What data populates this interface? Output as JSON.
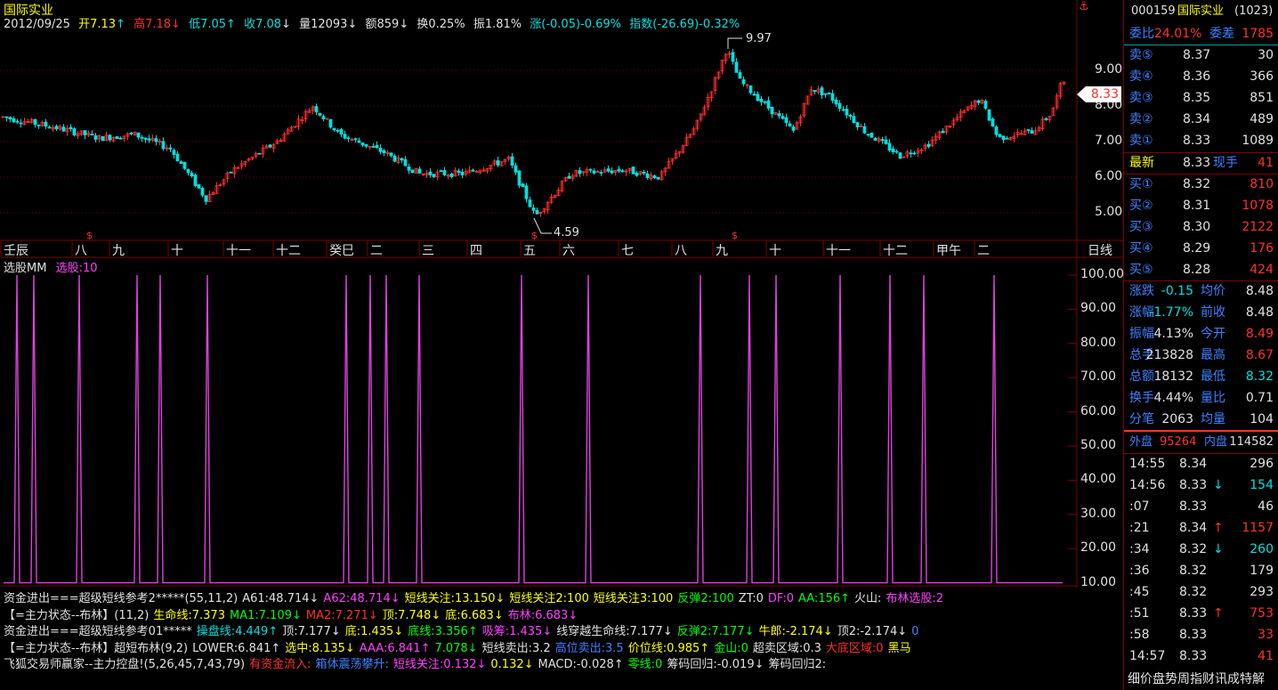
{
  "header": {
    "stock_name": "国际实业",
    "date": "2012/09/25",
    "open": "开7.13",
    "high": "高7.18",
    "low": "低7.05",
    "close": "收7.08",
    "volume": "量12093",
    "amount": "额859",
    "turnover": "换0.25%",
    "amplitude": "振1.81%",
    "change": "涨(-0.05)-0.69%",
    "index_change": "指数(-26.69)-0.32%"
  },
  "price_axis": [
    "9.00",
    "8.00",
    "7.00",
    "6.00",
    "5.00"
  ],
  "current_price_tag": "8.33",
  "high_mark": "9.97",
  "low_mark": "4.59",
  "time_axis": [
    "壬辰",
    "八",
    "九",
    "十",
    "十一",
    "十二",
    "癸巳",
    "二",
    "三",
    "四",
    "五",
    "六",
    "七",
    "八",
    "九",
    "十",
    "十一",
    "十二",
    "甲午",
    "二"
  ],
  "period_label": "日线",
  "indicator": {
    "name": "选股MM",
    "value_label": "选股:10",
    "axis": [
      "100.00",
      "90.00",
      "80.00",
      "70.00",
      "60.00",
      "50.00",
      "40.00",
      "30.00",
      "20.00",
      "10.00"
    ]
  },
  "formula_lines": [
    [
      {
        "t": "资金进出===超级短线参考2*****(55,11,2)",
        "c": "white"
      },
      {
        "t": "A61:48.714↓",
        "c": "white"
      },
      {
        "t": "A62:48.714↓",
        "c": "mag"
      },
      {
        "t": "短线关注:13.150↓",
        "c": "yellow"
      },
      {
        "t": "短线关注2:100",
        "c": "yellow"
      },
      {
        "t": "短线关注3:100",
        "c": "yellow"
      },
      {
        "t": "反弹2:100",
        "c": "green"
      },
      {
        "t": "ZT:0",
        "c": "white"
      },
      {
        "t": "DF:0",
        "c": "mag"
      },
      {
        "t": "AA:156↑",
        "c": "green"
      },
      {
        "t": "火山:",
        "c": "white"
      },
      {
        "t": "布林选股:2",
        "c": "mag"
      }
    ],
    [
      {
        "t": "【=主力状态--布林】(11,2)",
        "c": "white"
      },
      {
        "t": "生命线:7.373",
        "c": "yellow"
      },
      {
        "t": "MA1:7.109↓",
        "c": "green"
      },
      {
        "t": "MA2:7.271↓",
        "c": "red"
      },
      {
        "t": "顶:7.748↓",
        "c": "yellow"
      },
      {
        "t": "底:6.683↓",
        "c": "yellow"
      },
      {
        "t": "布林:6.683↓",
        "c": "mag"
      }
    ],
    [
      {
        "t": "资金进出===超级短线参考01*****",
        "c": "white"
      },
      {
        "t": "操盘线:4.449↑",
        "c": "cyan"
      },
      {
        "t": "顶:7.177↓",
        "c": "white"
      },
      {
        "t": "底:1.435↓",
        "c": "yellow"
      },
      {
        "t": "底线:3.356↑",
        "c": "green"
      },
      {
        "t": "吸筹:1.435↓",
        "c": "mag"
      },
      {
        "t": "线穿越生命线:7.177↓",
        "c": "white"
      },
      {
        "t": "反弹2:7.177↓",
        "c": "green"
      },
      {
        "t": "牛郎:-2.174↓",
        "c": "yellow"
      },
      {
        "t": "顶2:-2.174↓",
        "c": "white"
      },
      {
        "t": "0",
        "c": "blue"
      }
    ],
    [
      {
        "t": "【=主力状态--布林】超短布林(9,2)",
        "c": "white"
      },
      {
        "t": "LOWER:6.841↑",
        "c": "white"
      },
      {
        "t": "选中:8.135↓",
        "c": "yellow"
      },
      {
        "t": "AAA:6.841↑",
        "c": "mag"
      },
      {
        "t": "7.078↓",
        "c": "green"
      },
      {
        "t": "短线卖出:3.2",
        "c": "white"
      },
      {
        "t": "高位卖出:3.5",
        "c": "blue"
      },
      {
        "t": "价位线:0.985↑",
        "c": "yellow"
      },
      {
        "t": "金山:0",
        "c": "green"
      },
      {
        "t": "超卖区域:0.3",
        "c": "white"
      },
      {
        "t": "大底区域:0",
        "c": "red"
      },
      {
        "t": "黑马",
        "c": "yellow"
      }
    ],
    [
      {
        "t": "飞狐交易师赢家--主力控盘!(5,26,45,7,43,79)",
        "c": "white"
      },
      {
        "t": "有资金流入:",
        "c": "red"
      },
      {
        "t": "箱体震荡攀升:",
        "c": "blue"
      },
      {
        "t": "短线关注:0.132↓",
        "c": "mag"
      },
      {
        "t": "0.132↓",
        "c": "yellow"
      },
      {
        "t": "MACD:-0.028↑",
        "c": "white"
      },
      {
        "t": "零线:0",
        "c": "green"
      },
      {
        "t": "筹码回归:-0.019↓",
        "c": "white"
      },
      {
        "t": "筹码回归2:",
        "c": "white"
      }
    ]
  ],
  "right_panel": {
    "code": "000159",
    "name": "国际实业",
    "count": "(1023)",
    "weibi_label": "委比",
    "weibi_value": "24.01%",
    "weicha_label": "委差",
    "weicha_value": "1785",
    "sell": [
      {
        "label": "卖⑤",
        "price": "8.37",
        "vol": "30"
      },
      {
        "label": "卖④",
        "price": "8.36",
        "vol": "366"
      },
      {
        "label": "卖③",
        "price": "8.35",
        "vol": "851"
      },
      {
        "label": "卖②",
        "price": "8.34",
        "vol": "489"
      },
      {
        "label": "卖①",
        "price": "8.33",
        "vol": "1089"
      }
    ],
    "latest_label": "最新",
    "latest_value": "8.33",
    "xianshou_label": "现手",
    "xianshou_value": "41",
    "buy": [
      {
        "label": "买①",
        "price": "8.32",
        "vol": "810"
      },
      {
        "label": "买②",
        "price": "8.31",
        "vol": "1078"
      },
      {
        "label": "买③",
        "price": "8.30",
        "vol": "2122"
      },
      {
        "label": "买④",
        "price": "8.29",
        "vol": "176"
      },
      {
        "label": "买⑤",
        "price": "8.28",
        "vol": "424"
      }
    ],
    "stats": [
      {
        "l1": "涨跌",
        "v1": "-0.15",
        "l2": "均价",
        "v2": "8.48",
        "c1": "cyan",
        "c2": "white"
      },
      {
        "l1": "涨幅",
        "v1": "-1.77%",
        "l2": "前收",
        "v2": "8.48",
        "c1": "cyan",
        "c2": "white"
      },
      {
        "l1": "振幅",
        "v1": "4.13%",
        "l2": "今开",
        "v2": "8.49",
        "c1": "white",
        "c2": "red"
      },
      {
        "l1": "总手",
        "v1": "213828",
        "l2": "最高",
        "v2": "8.67",
        "c1": "white",
        "c2": "red"
      },
      {
        "l1": "总额",
        "v1": "18132",
        "l2": "最低",
        "v2": "8.32",
        "c1": "white",
        "c2": "cyan"
      },
      {
        "l1": "换手",
        "v1": "4.44%",
        "l2": "量比",
        "v2": "0.71",
        "c1": "white",
        "c2": "white"
      },
      {
        "l1": "分笔",
        "v1": "2063",
        "l2": "均量",
        "v2": "104",
        "c1": "white",
        "c2": "white"
      }
    ],
    "waipan_label": "外盘",
    "waipan_value": "95264",
    "neipan_label": "内盘",
    "neipan_value": "114582",
    "ticks": [
      {
        "time": "14:55",
        "price": "8.34",
        "arrow": "",
        "vol": "296",
        "vc": "white"
      },
      {
        "time": "14:56",
        "price": "8.33",
        "arrow": "↓",
        "vol": "154",
        "vc": "cyan"
      },
      {
        "time": ":07",
        "price": "8.33",
        "arrow": "",
        "vol": "46",
        "vc": "white"
      },
      {
        "time": ":21",
        "price": "8.34",
        "arrow": "↑",
        "vol": "1157",
        "vc": "red"
      },
      {
        "time": ":34",
        "price": "8.32",
        "arrow": "↓",
        "vol": "260",
        "vc": "cyan"
      },
      {
        "time": ":36",
        "price": "8.32",
        "arrow": "",
        "vol": "179",
        "vc": "white"
      },
      {
        "time": ":45",
        "price": "8.32",
        "arrow": "",
        "vol": "293",
        "vc": "white"
      },
      {
        "time": ":51",
        "price": "8.33",
        "arrow": "↑",
        "vol": "753",
        "vc": "red"
      },
      {
        "time": ":58",
        "price": "8.33",
        "arrow": "",
        "vol": "33",
        "vc": "red"
      },
      {
        "time": "14:57",
        "price": "8.33",
        "arrow": "",
        "vol": "41",
        "vc": "red"
      }
    ],
    "bottom_tabs": "细价盘势周指财讯成特解"
  }
}
